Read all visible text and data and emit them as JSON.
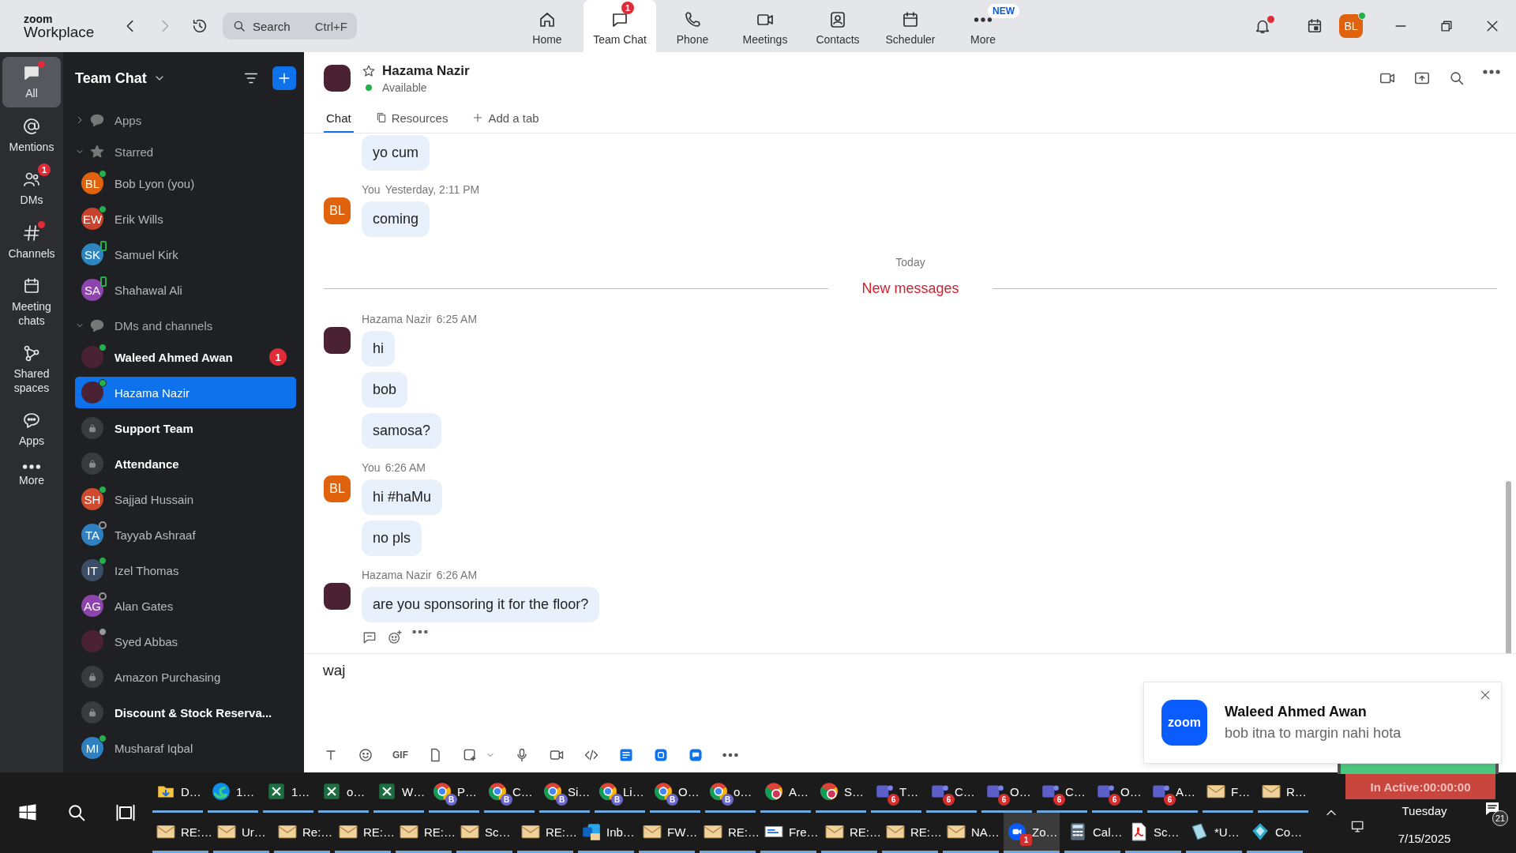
{
  "app_header": {
    "logo_top": "zoom",
    "logo_bottom": "Workplace",
    "search": {
      "placeholder": "Search",
      "shortcut": "Ctrl+F"
    },
    "nav": [
      {
        "label": "Home",
        "kind": "home",
        "selected": false
      },
      {
        "label": "Team Chat",
        "kind": "chat",
        "selected": true,
        "badge": "1"
      },
      {
        "label": "Phone",
        "kind": "phone",
        "selected": false
      },
      {
        "label": "Meetings",
        "kind": "meetings",
        "selected": false
      },
      {
        "label": "Contacts",
        "kind": "contacts",
        "selected": false
      },
      {
        "label": "Scheduler",
        "kind": "scheduler",
        "selected": false
      },
      {
        "tag": "NEW",
        "label": "More",
        "kind": "more",
        "selected": false
      }
    ],
    "bell_alert": true,
    "avatar": {
      "initials": "BL",
      "color": "#e0620d",
      "status": {
        "kind": "online"
      }
    }
  },
  "rail": [
    {
      "label": "All",
      "kind": "all",
      "selected": true,
      "alert": true
    },
    {
      "label": "Mentions",
      "kind": "mentions",
      "selected": false,
      "alert": false
    },
    {
      "label": "DMs",
      "kind": "dms",
      "selected": false,
      "alert": false,
      "badge": "1"
    },
    {
      "label": "Channels",
      "kind": "channels",
      "selected": false,
      "alert": true
    },
    {
      "label": "Meeting chats",
      "kind": "meetings",
      "selected": false,
      "alert": false
    },
    {
      "label": "Shared spaces",
      "kind": "spaces",
      "selected": false,
      "alert": false
    },
    {
      "label": "Apps",
      "kind": "apps",
      "selected": false,
      "alert": false
    },
    {
      "label": "More",
      "kind": "more",
      "selected": false,
      "alert": false
    }
  ],
  "sidebar": {
    "title": "Team Chat",
    "sections": [
      {
        "label": "Apps",
        "kind": "apps",
        "expanded": false
      },
      {
        "label": "Starred",
        "kind": "starred",
        "expanded": true,
        "items": [
          {
            "name": "Bob Lyon (you)",
            "avatar": {
              "kind": "initials",
              "initials": "BL",
              "color": "#e0620d"
            },
            "status": {
              "kind": "online"
            },
            "bold": false,
            "selected": false
          },
          {
            "name": "Erik Wills",
            "avatar": {
              "kind": "initials",
              "initials": "EW",
              "color": "#c9422b"
            },
            "status": {
              "kind": "online"
            },
            "bold": false,
            "selected": false
          },
          {
            "name": "Samuel Kirk",
            "avatar": {
              "kind": "initials",
              "initials": "SK",
              "color": "#2e86c1"
            },
            "status": {
              "kind": "mobile"
            },
            "bold": false,
            "selected": false
          },
          {
            "name": "Shahawal Ali",
            "avatar": {
              "kind": "initials",
              "initials": "SA",
              "color": "#8e44ad"
            },
            "status": {
              "kind": "mobile"
            },
            "bold": false,
            "selected": false
          }
        ]
      },
      {
        "label": "DMs and channels",
        "kind": "dms",
        "expanded": true,
        "items": [
          {
            "name": "Waleed Ahmed Awan",
            "avatar": {
              "kind": "photo"
            },
            "status": {
              "kind": "online"
            },
            "bold": true,
            "selected": false,
            "badge": "1"
          },
          {
            "name": "Hazama Nazir",
            "avatar": {
              "kind": "photo"
            },
            "status": {
              "kind": "online"
            },
            "bold": false,
            "selected": true
          },
          {
            "name": "Support Team",
            "avatar": {
              "kind": "lock"
            },
            "bold": true,
            "selected": false
          },
          {
            "name": "Attendance",
            "avatar": {
              "kind": "lock"
            },
            "bold": true,
            "selected": false
          },
          {
            "name": "Sajjad Hussain",
            "avatar": {
              "kind": "initials",
              "initials": "SH",
              "color": "#d04a2e"
            },
            "status": {
              "kind": "online"
            },
            "bold": false,
            "selected": false
          },
          {
            "name": "Tayyab Ashraaf",
            "avatar": {
              "kind": "initials",
              "initials": "TA",
              "color": "#2f80c0"
            },
            "status": {
              "kind": "offline"
            },
            "bold": false,
            "selected": false
          },
          {
            "name": "Izel Thomas",
            "avatar": {
              "kind": "initials",
              "initials": "IT",
              "color": "#3c4e66"
            },
            "status": {
              "kind": "online"
            },
            "bold": false,
            "selected": false
          },
          {
            "name": "Alan Gates",
            "avatar": {
              "kind": "initials",
              "initials": "AG",
              "color": "#8e44ad"
            },
            "status": {
              "kind": "offline"
            },
            "bold": false,
            "selected": false
          },
          {
            "name": "Syed Abbas",
            "avatar": {
              "kind": "photo"
            },
            "status": {
              "kind": "away"
            },
            "bold": false,
            "selected": false
          },
          {
            "name": "Amazon Purchasing",
            "avatar": {
              "kind": "lock"
            },
            "bold": false,
            "selected": false
          },
          {
            "name": "Discount & Stock Reserva...",
            "avatar": {
              "kind": "lock"
            },
            "bold": true,
            "selected": false
          },
          {
            "name": "Musharaf Iqbal",
            "avatar": {
              "kind": "initials",
              "initials": "MI",
              "color": "#2f80c0"
            },
            "status": {
              "kind": "online"
            },
            "bold": false,
            "selected": false
          }
        ]
      }
    ]
  },
  "chat": {
    "contact": {
      "name": "Hazama Nazir",
      "status": "Available"
    },
    "tabs": [
      {
        "label": "Chat",
        "kind": "chat",
        "selected": true
      },
      {
        "label": "Resources",
        "kind": "resources",
        "selected": false
      },
      {
        "label": "Add a tab",
        "kind": "add",
        "selected": false
      }
    ],
    "timeline": [
      {
        "kind": "group",
        "messages": [
          "yo cum"
        ]
      },
      {
        "kind": "group",
        "sender": "You",
        "time": "Yesterday, 2:11 PM",
        "avatar": {
          "kind": "initials",
          "initials": "BL",
          "color": "#e0620d"
        },
        "messages": [
          "coming"
        ]
      },
      {
        "kind": "day",
        "label": "Today"
      },
      {
        "kind": "divider",
        "label": "New messages"
      },
      {
        "kind": "group",
        "sender": "Hazama Nazir",
        "time": "6:25 AM",
        "avatar": {
          "kind": "photo"
        },
        "messages": [
          "hi",
          "bob",
          "samosa?"
        ]
      },
      {
        "kind": "group",
        "sender": "You",
        "time": "6:26 AM",
        "avatar": {
          "kind": "initials",
          "initials": "BL",
          "color": "#e0620d"
        },
        "messages": [
          "hi #haMu",
          "no pls"
        ]
      },
      {
        "kind": "group",
        "sender": "Hazama Nazir",
        "time": "6:26 AM",
        "avatar": {
          "kind": "photo"
        },
        "messages": [
          "are you sponsoring it for the floor?"
        ],
        "actions": true
      }
    ],
    "composer": {
      "value": "waj",
      "tools": [
        {
          "kind": "text"
        },
        {
          "kind": "emoji"
        },
        {
          "kind": "gif",
          "label": "GIF"
        },
        {
          "kind": "file"
        },
        {
          "kind": "screenshot"
        },
        {
          "kind": "caret"
        },
        {
          "kind": "mic"
        },
        {
          "kind": "video"
        },
        {
          "kind": "code"
        },
        {
          "kind": "notes"
        },
        {
          "kind": "whiteboard"
        },
        {
          "kind": "chatapp"
        },
        {
          "kind": "more"
        }
      ]
    }
  },
  "toast": {
    "logo": "zoom",
    "title": "Waleed Ahmed Awan",
    "body": "bob itna to margin nahi hota"
  },
  "timer": "In Active:00:00:00",
  "taskbar": {
    "upper": [
      {
        "label": "D…",
        "kind": "folder",
        "selected": false
      },
      {
        "label": "1…",
        "kind": "edge",
        "selected": false
      },
      {
        "label": "1…",
        "kind": "excel",
        "selected": false
      },
      {
        "label": "o…",
        "kind": "excel",
        "selected": false
      },
      {
        "label": "W…",
        "kind": "excel",
        "selected": false
      },
      {
        "label": "P…",
        "kind": "chrome",
        "badge": "B",
        "selected": false
      },
      {
        "label": "C…",
        "kind": "chrome",
        "badge": "B",
        "selected": false
      },
      {
        "label": "Si…",
        "kind": "chrome",
        "badge": "B",
        "selected": false
      },
      {
        "label": "Li…",
        "kind": "chrome",
        "badge": "B",
        "selected": false
      },
      {
        "label": "O…",
        "kind": "chrome",
        "badge": "B",
        "selected": false
      },
      {
        "label": "o…",
        "kind": "chrome",
        "badge": "B",
        "selected": false
      },
      {
        "label": "A…",
        "kind": "chrome2",
        "selected": false
      },
      {
        "label": "S…",
        "kind": "chrome2",
        "selected": false
      },
      {
        "label": "T…",
        "kind": "teams",
        "badge": "6",
        "selected": false
      },
      {
        "label": "C…",
        "kind": "teams",
        "badge": "6",
        "selected": false
      },
      {
        "label": "O…",
        "kind": "teams",
        "badge": "6",
        "selected": false
      },
      {
        "label": "C…",
        "kind": "teams",
        "badge": "6",
        "selected": false
      },
      {
        "label": "O…",
        "kind": "teams",
        "badge": "6",
        "selected": false
      },
      {
        "label": "A…",
        "kind": "teams",
        "badge": "6",
        "selected": false
      },
      {
        "label": "F…",
        "kind": "mail",
        "selected": false
      },
      {
        "label": "R…",
        "kind": "mail",
        "selected": false
      }
    ],
    "lower": [
      {
        "label": "RE:…",
        "kind": "mail",
        "selected": false
      },
      {
        "label": "Ur…",
        "kind": "mail",
        "selected": false
      },
      {
        "label": "Re:…",
        "kind": "mail",
        "selected": false
      },
      {
        "label": "RE:…",
        "kind": "mail",
        "selected": false
      },
      {
        "label": "RE:…",
        "kind": "mail",
        "selected": false
      },
      {
        "label": "Sc…",
        "kind": "mail",
        "selected": false
      },
      {
        "label": "RE:…",
        "kind": "mail",
        "selected": false
      },
      {
        "label": "Inb…",
        "kind": "outlook",
        "selected": false
      },
      {
        "label": "FW…",
        "kind": "mail",
        "selected": false
      },
      {
        "label": "RE:…",
        "kind": "mail",
        "selected": false
      },
      {
        "label": "Fre…",
        "kind": "doc",
        "selected": false
      },
      {
        "label": "RE:…",
        "kind": "mail",
        "selected": false
      },
      {
        "label": "RE:…",
        "kind": "mail",
        "selected": false
      },
      {
        "label": "NA…",
        "kind": "mail",
        "selected": false
      },
      {
        "label": "Zo…",
        "kind": "zoom",
        "badge": "1",
        "selected": true
      },
      {
        "label": "Cal…",
        "kind": "calc",
        "selected": false
      },
      {
        "label": "Sc…",
        "kind": "pdf",
        "selected": false
      },
      {
        "label": "*U…",
        "kind": "notepad",
        "selected": false
      },
      {
        "label": "Co…",
        "kind": "app",
        "selected": false
      }
    ],
    "tray": {
      "day": "Tuesday",
      "date": "7/15/2025",
      "notifications": "21"
    }
  }
}
